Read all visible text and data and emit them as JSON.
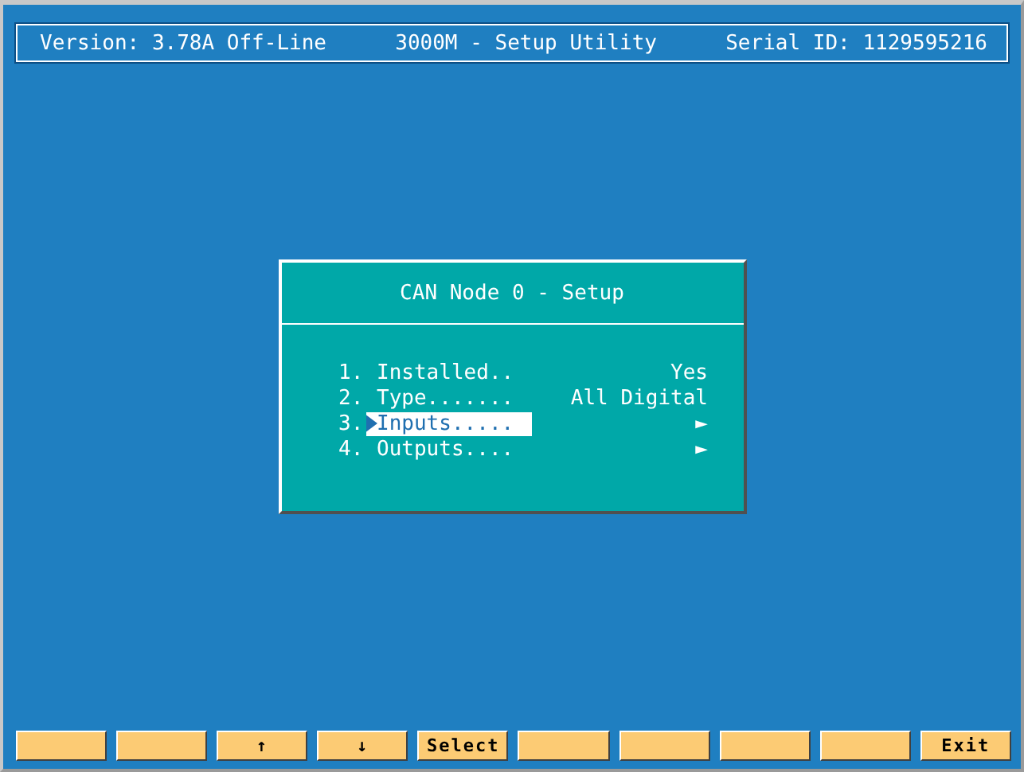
{
  "header": {
    "version": "Version: 3.78A Off-Line",
    "title": "3000M - Setup Utility",
    "serial": "Serial ID: 1129595216"
  },
  "dialog": {
    "title": "CAN Node 0 - Setup",
    "items": [
      {
        "number": "1.",
        "label": "Installed..",
        "value": "Yes",
        "selected": false
      },
      {
        "number": "2.",
        "label": "Type.......",
        "value": "All Digital",
        "selected": false
      },
      {
        "number": "3.",
        "label": "Inputs.....",
        "value": "►",
        "selected": true
      },
      {
        "number": "4.",
        "label": "Outputs....",
        "value": "►",
        "selected": false
      }
    ]
  },
  "function_keys": [
    {
      "kind": "blank"
    },
    {
      "kind": "blank"
    },
    {
      "kind": "labeled",
      "label": "↑"
    },
    {
      "kind": "labeled",
      "label": "↓"
    },
    {
      "kind": "labeled",
      "label": "Select"
    },
    {
      "kind": "blank"
    },
    {
      "kind": "blank"
    },
    {
      "kind": "blank"
    },
    {
      "kind": "blank"
    },
    {
      "kind": "labeled",
      "label": "Exit"
    }
  ]
}
